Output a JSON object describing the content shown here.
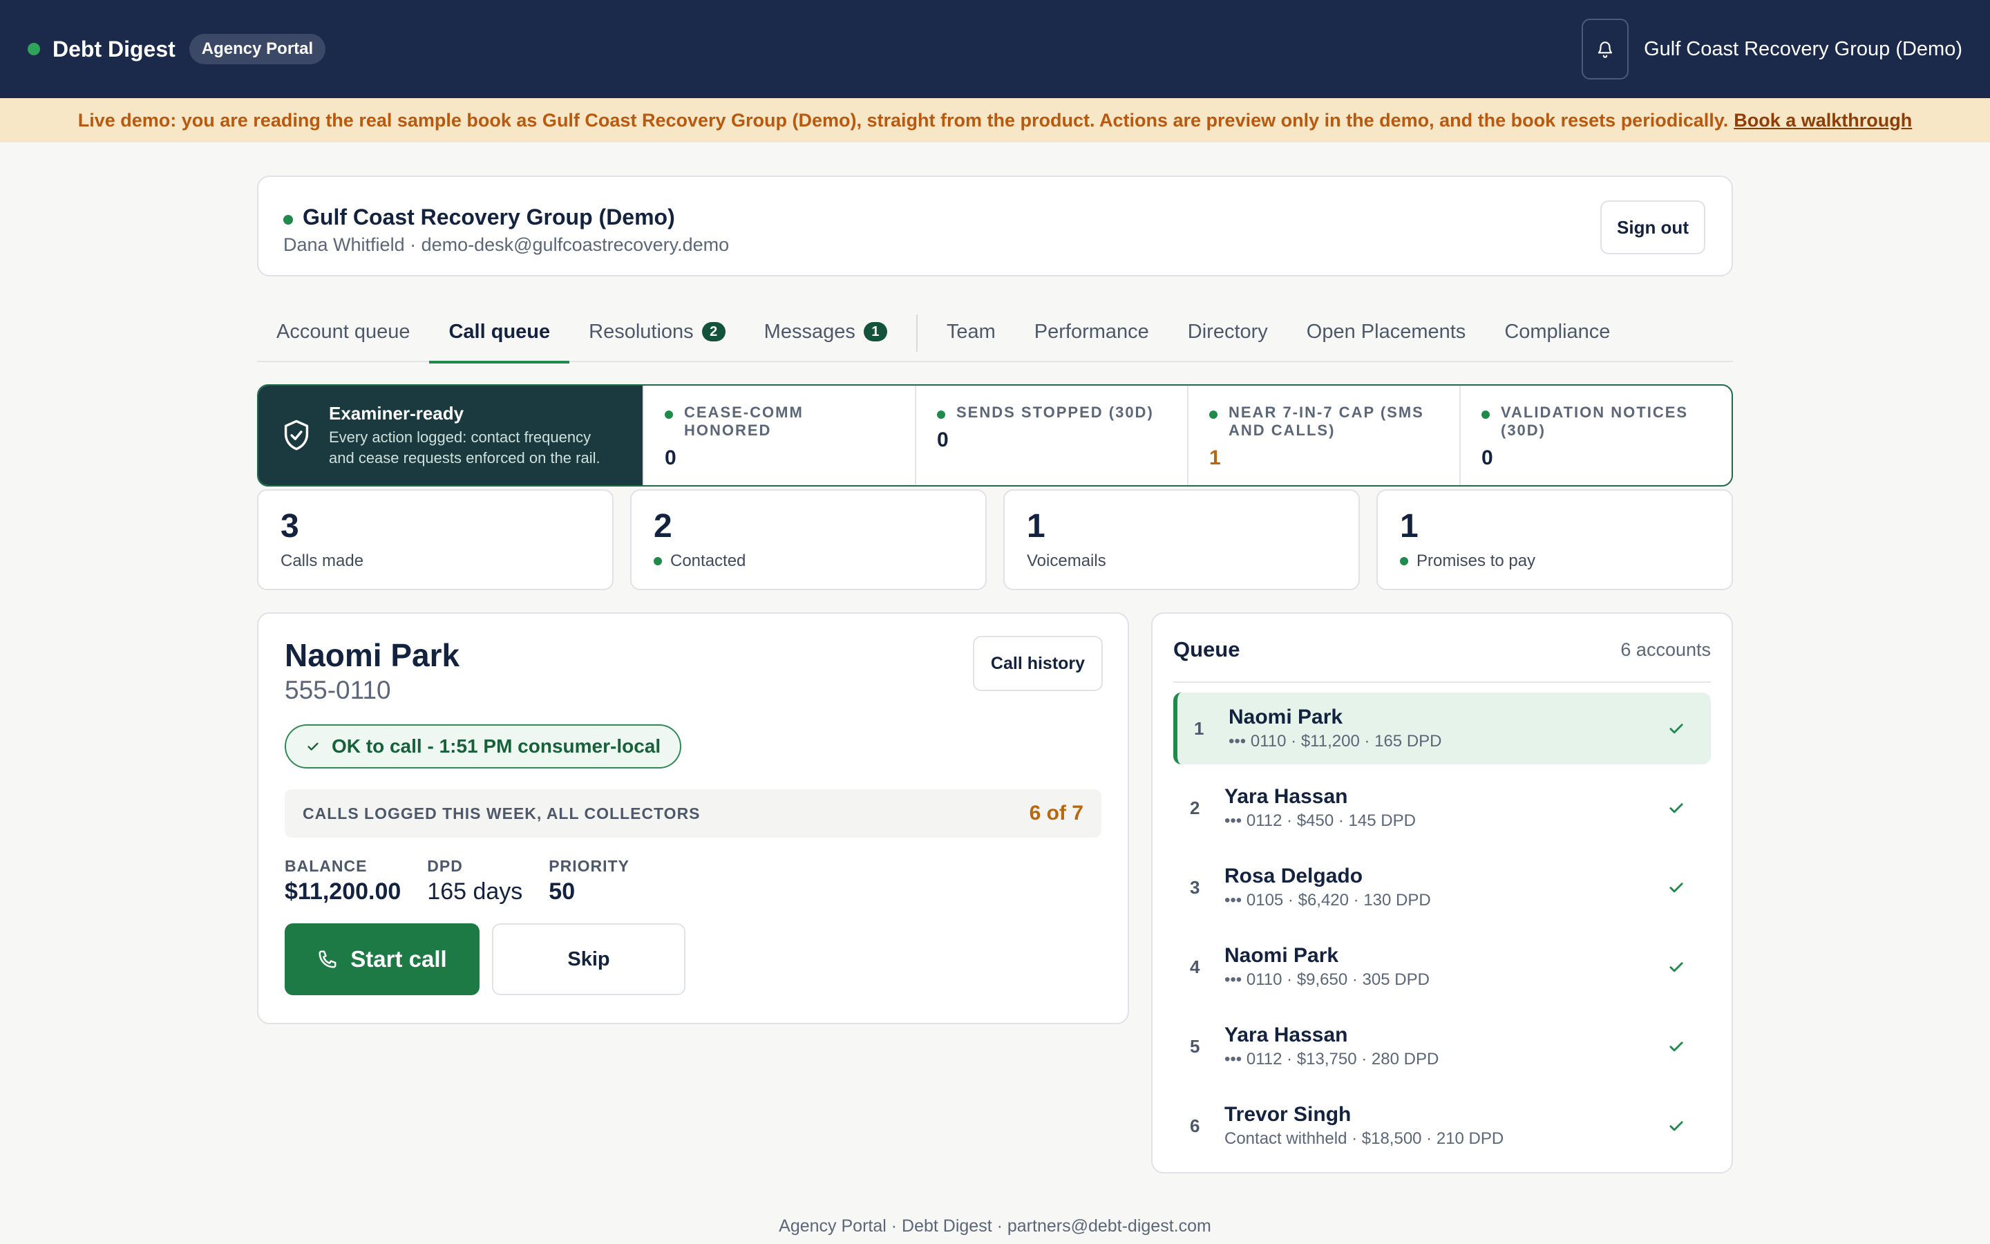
{
  "topbar": {
    "brand": "Debt Digest",
    "portal_badge": "Agency Portal",
    "org_name": "Gulf Coast Recovery Group (Demo)"
  },
  "banner": {
    "text": "Live demo: you are reading the real sample book as Gulf Coast Recovery Group (Demo), straight from the product. Actions are preview only in the demo, and the book resets periodically.",
    "link": "Book a walkthrough"
  },
  "account": {
    "org": "Gulf Coast Recovery Group (Demo)",
    "user_line": "Dana Whitfield · demo-desk@gulfcoastrecovery.demo",
    "sign_out": "Sign out"
  },
  "tabs": [
    {
      "label": "Account queue"
    },
    {
      "label": "Call queue"
    },
    {
      "label": "Resolutions",
      "badge": "2"
    },
    {
      "label": "Messages",
      "badge": "1"
    },
    {
      "label": "Team"
    },
    {
      "label": "Performance"
    },
    {
      "label": "Directory"
    },
    {
      "label": "Open Placements"
    },
    {
      "label": "Compliance"
    }
  ],
  "examiner": {
    "title": "Examiner-ready",
    "desc": "Every action logged: contact frequency and cease requests enforced on the rail.",
    "stats": [
      {
        "label": "CEASE-COMM HONORED",
        "value": "0"
      },
      {
        "label": "SENDS STOPPED (30D)",
        "value": "0"
      },
      {
        "label": "NEAR 7-IN-7 CAP (SMS AND CALLS)",
        "value": "1"
      },
      {
        "label": "VALIDATION NOTICES (30D)",
        "value": "0"
      }
    ]
  },
  "kpis": [
    {
      "value": "3",
      "label": "Calls made"
    },
    {
      "value": "2",
      "label": "Contacted"
    },
    {
      "value": "1",
      "label": "Voicemails"
    },
    {
      "value": "1",
      "label": "Promises to pay"
    }
  ],
  "detail": {
    "name": "Naomi Park",
    "phone": "555-0110",
    "call_history": "Call history",
    "ok_status": "OK to call - 1:51 PM consumer-local",
    "calls_logged_label": "CALLS LOGGED THIS WEEK, ALL COLLECTORS",
    "calls_logged_value": "6 of 7",
    "balance_label": "BALANCE",
    "balance_value": "$11,200.00",
    "dpd_label": "DPD",
    "dpd_value": "165 days",
    "priority_label": "PRIORITY",
    "priority_value": "50",
    "start_call": "Start call",
    "skip": "Skip"
  },
  "queue": {
    "title": "Queue",
    "count": "6 accounts",
    "items": [
      {
        "num": "1",
        "name": "Naomi Park",
        "meta": "••• 0110 · $11,200 · 165 DPD"
      },
      {
        "num": "2",
        "name": "Yara Hassan",
        "meta": "••• 0112 · $450 · 145 DPD"
      },
      {
        "num": "3",
        "name": "Rosa Delgado",
        "meta": "••• 0105 · $6,420 · 130 DPD"
      },
      {
        "num": "4",
        "name": "Naomi Park",
        "meta": "••• 0110 · $9,650 · 305 DPD"
      },
      {
        "num": "5",
        "name": "Yara Hassan",
        "meta": "••• 0112 · $13,750 · 280 DPD"
      },
      {
        "num": "6",
        "name": "Trevor Singh",
        "meta": "Contact withheld · $18,500 · 210 DPD"
      }
    ]
  },
  "footer": "Agency Portal · Debt Digest · partners@debt-digest.com",
  "colors": {
    "nav": "#1b2a4a",
    "accent": "#1f8a4c",
    "warn": "#b8670f",
    "banner_bg": "#f8e7c6"
  }
}
